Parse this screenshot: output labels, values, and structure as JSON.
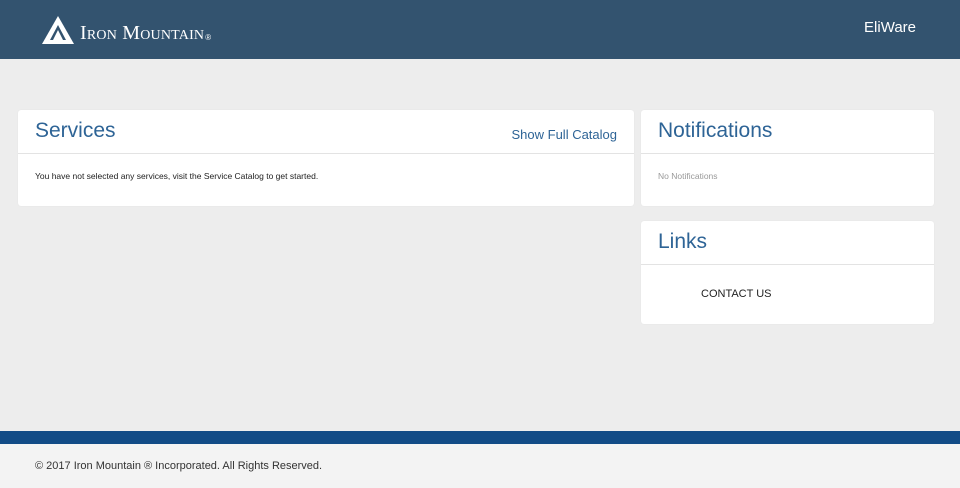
{
  "header": {
    "logo_text": "Iron Mountain",
    "logo_tm": "®",
    "user_name": "EliWare",
    "background": "#33536f"
  },
  "services": {
    "title": "Services",
    "action_label": "Show Full Catalog",
    "message": "You have not selected any services, visit the Service Catalog to get started."
  },
  "notifications": {
    "title": "Notifications",
    "empty_text": "No Notifications"
  },
  "links": {
    "title": "Links",
    "items": [
      {
        "label": "CONTACT US"
      }
    ]
  },
  "footer": {
    "copyright": "© 2017 Iron Mountain ® Incorporated. All Rights Reserved.",
    "band_color": "#124b86"
  },
  "icons": [
    "mountain-logo-icon"
  ],
  "colors": {
    "accent": "#2e6496",
    "page_background": "#ededed"
  }
}
